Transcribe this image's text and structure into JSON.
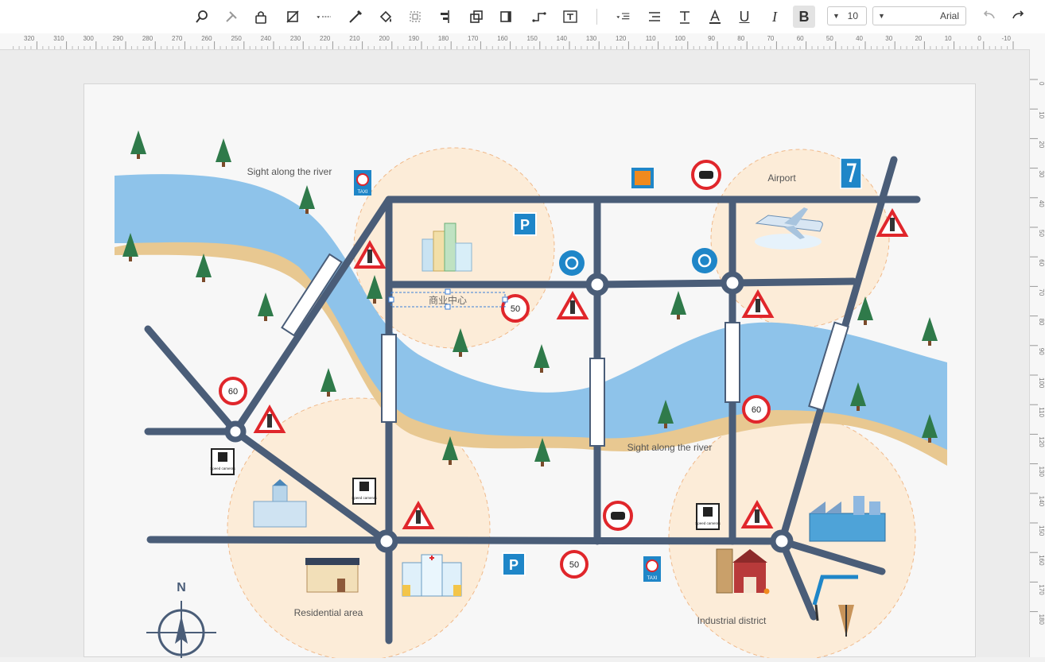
{
  "toolbar": {
    "font_size": "10",
    "font_name": "Arial",
    "icons": [
      "redo-icon",
      "undo-icon",
      "bold-icon",
      "italic-icon",
      "underline-icon",
      "font-color-icon",
      "text-style-icon",
      "align-icon",
      "text-spacing-icon",
      "text-box-icon",
      "connector-icon",
      "group-icon",
      "arrange-icon",
      "align-objects-icon",
      "fill-icon",
      "line-color-icon",
      "line-style-icon",
      "crop-icon",
      "lock-icon",
      "tools-icon",
      "search-icon"
    ]
  },
  "ruler": {
    "h_ticks": [
      "-10",
      "0",
      "10",
      "20",
      "30",
      "40",
      "50",
      "60",
      "70",
      "80",
      "90",
      "100",
      "110",
      "120",
      "130",
      "140",
      "150",
      "160",
      "170",
      "180",
      "190",
      "200",
      "210",
      "220",
      "230",
      "240",
      "250",
      "260",
      "270",
      "280",
      "290",
      "300",
      "310",
      "320"
    ],
    "v_ticks": [
      "0",
      "10",
      "20",
      "30",
      "40",
      "50",
      "60",
      "70",
      "80",
      "90",
      "100",
      "110",
      "120",
      "130",
      "140",
      "150",
      "160",
      "170",
      "180"
    ]
  },
  "map": {
    "labels": {
      "sight_top": "Sight along the river",
      "sight_mid": "Sight along the river",
      "airport": "Airport",
      "residential": "Residential area",
      "industrial": "Industrial district",
      "north": "N",
      "selected_text": "商业中心"
    },
    "speed_signs": [
      "50",
      "60",
      "60",
      "50"
    ],
    "camera_sign": "Speed cameras",
    "taxi_sign": "TAXI",
    "parking_sign": "P",
    "colors": {
      "road": "#4a5d78",
      "river": "#8ec3ea",
      "bank": "#e8c891",
      "zone": "#fcecd8",
      "tree": "#2f7a4a",
      "sign_red": "#e0262b",
      "blue_sign": "#1f86c8"
    }
  }
}
